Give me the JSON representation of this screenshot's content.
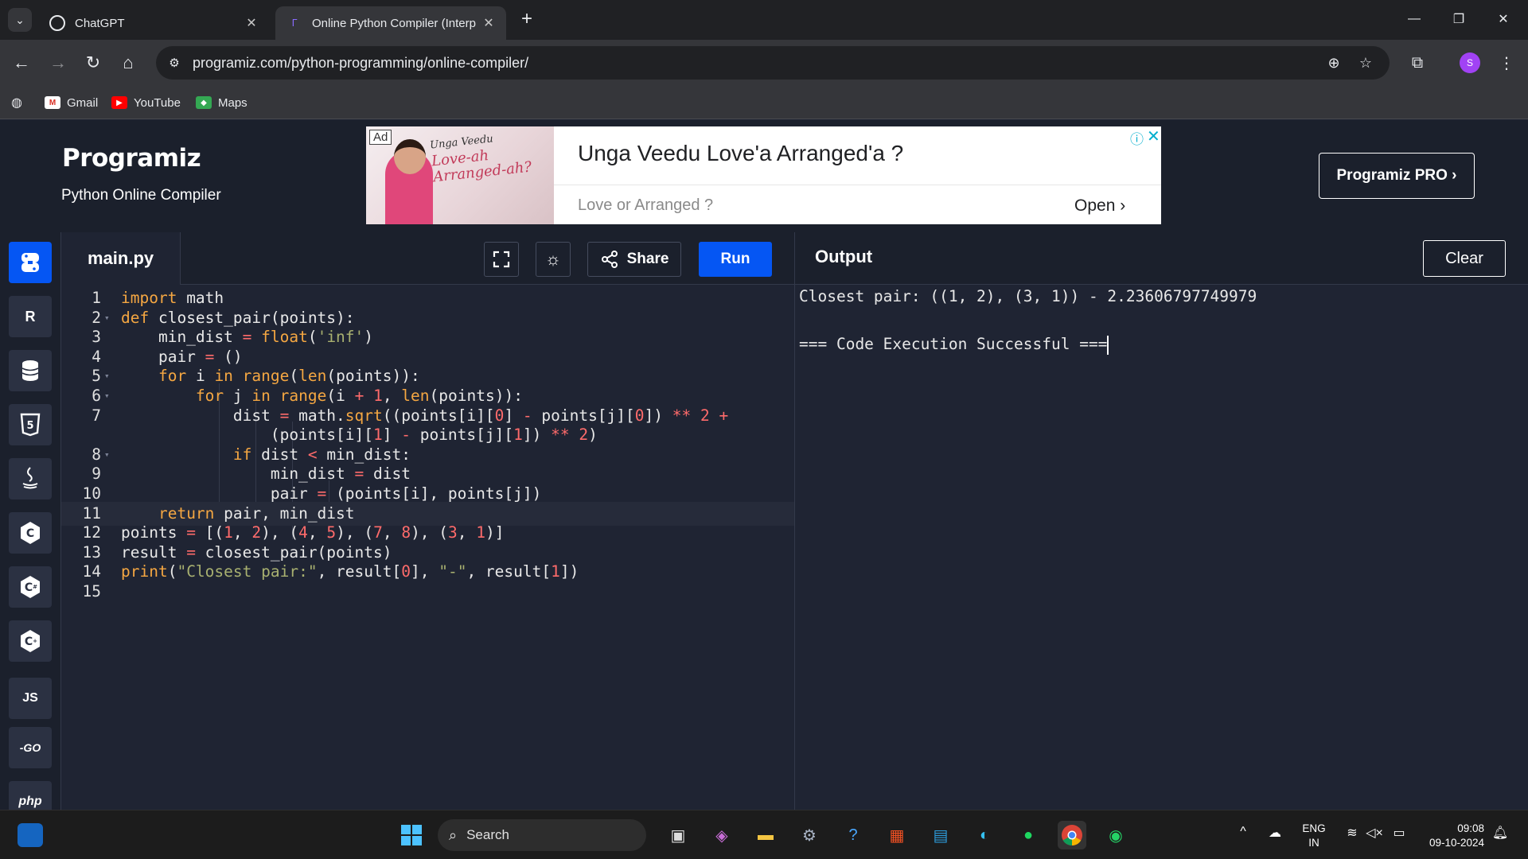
{
  "browser": {
    "tabs": [
      {
        "title": "ChatGPT",
        "active": false
      },
      {
        "title": "Online Python Compiler (Interp",
        "active": true
      }
    ],
    "url": "programiz.com/python-programming/online-compiler/",
    "bookmarks": [
      {
        "label": "Gmail",
        "icon": "gmail-icon"
      },
      {
        "label": "YouTube",
        "icon": "youtube-icon"
      },
      {
        "label": "Maps",
        "icon": "maps-icon"
      }
    ],
    "profile_initial": "S"
  },
  "header": {
    "logo": "Programiz",
    "subtitle": "Python Online Compiler",
    "pro_button": "Programiz PRO ›"
  },
  "ad": {
    "badge": "Ad",
    "image_text_small": "Unga Veedu",
    "image_text_1": "Love-ah",
    "image_text_2": "Arranged-ah?",
    "headline": "Unga Veedu Love'a Arranged'a ?",
    "subline": "Love or Arranged ?",
    "cta": "Open ›"
  },
  "languages": [
    {
      "name": "python-icon",
      "label": "",
      "active": true
    },
    {
      "name": "r-icon",
      "label": "R",
      "active": false
    },
    {
      "name": "sql-icon",
      "label": "",
      "active": false
    },
    {
      "name": "html-icon",
      "label": "5",
      "active": false
    },
    {
      "name": "java-icon",
      "label": "",
      "active": false
    },
    {
      "name": "c-icon",
      "label": "C",
      "active": false
    },
    {
      "name": "csharp-icon",
      "label": "C",
      "active": false
    },
    {
      "name": "cpp-icon",
      "label": "C",
      "active": false
    },
    {
      "name": "js-icon",
      "label": "JS",
      "active": false
    },
    {
      "name": "go-icon",
      "label": "-GO",
      "active": false
    },
    {
      "name": "php-icon",
      "label": "php",
      "active": false
    }
  ],
  "editor": {
    "filename": "main.py",
    "share_label": "Share",
    "run_label": "Run",
    "lines": [
      {
        "n": "1",
        "code": "import math"
      },
      {
        "n": "2",
        "code": "def closest_pair(points):"
      },
      {
        "n": "3",
        "code": "    min_dist = float('inf')"
      },
      {
        "n": "4",
        "code": "    pair = ()"
      },
      {
        "n": "5",
        "code": "    for i in range(len(points)):"
      },
      {
        "n": "6",
        "code": "        for j in range(i + 1, len(points)):"
      },
      {
        "n": "7",
        "code": "            dist = math.sqrt((points[i][0] - points[j][0]) ** 2 +"
      },
      {
        "n": "",
        "code": "                (points[i][1] - points[j][1]) ** 2)"
      },
      {
        "n": "8",
        "code": "            if dist < min_dist:"
      },
      {
        "n": "9",
        "code": "                min_dist = dist"
      },
      {
        "n": "10",
        "code": "                pair = (points[i], points[j])"
      },
      {
        "n": "11",
        "code": "    return pair, min_dist"
      },
      {
        "n": "12",
        "code": "points = [(1, 2), (4, 5), (7, 8), (3, 1)]"
      },
      {
        "n": "13",
        "code": "result = closest_pair(points)"
      },
      {
        "n": "14",
        "code": "print(\"Closest pair:\", result[0], \"-\", result[1])"
      },
      {
        "n": "15",
        "code": ""
      }
    ]
  },
  "output": {
    "title": "Output",
    "clear_label": "Clear",
    "lines": [
      "Closest pair: ((1, 2), (3, 1)) - 2.23606797749979",
      "",
      "=== Code Execution Successful ==="
    ]
  },
  "taskbar": {
    "search_placeholder": "Search",
    "language": "ENG",
    "region": "IN",
    "time": "09:08",
    "date": "09-10-2024"
  }
}
